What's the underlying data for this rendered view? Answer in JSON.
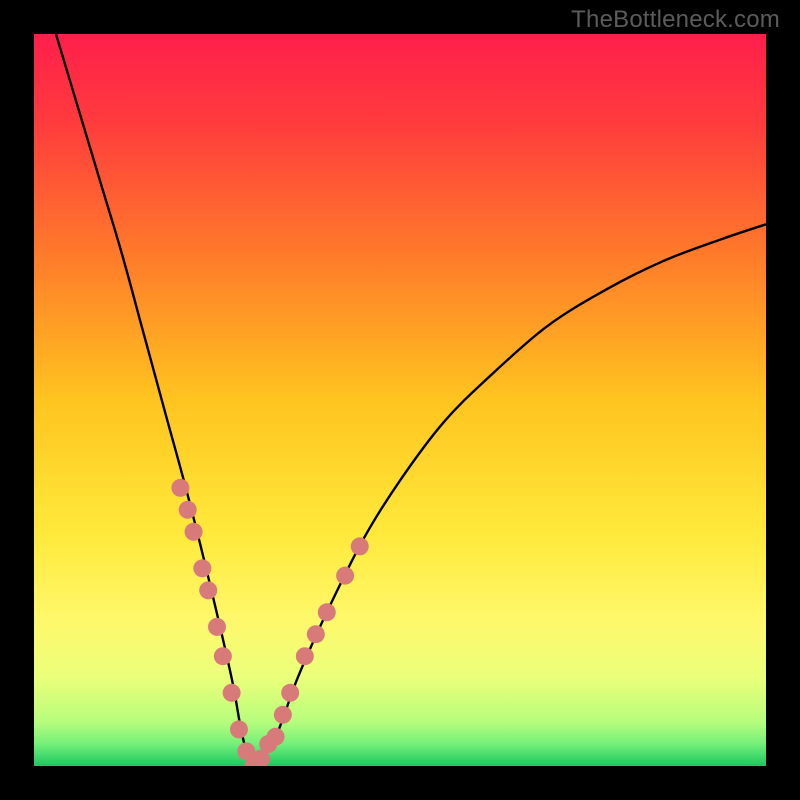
{
  "watermark": "TheBottleneck.com",
  "chart_data": {
    "type": "line",
    "title": "",
    "xlabel": "",
    "ylabel": "",
    "xlim": [
      0,
      100
    ],
    "ylim": [
      0,
      100
    ],
    "background_gradient_stops": [
      {
        "offset": 0.0,
        "color": "#ff1f4b"
      },
      {
        "offset": 0.12,
        "color": "#ff3b3d"
      },
      {
        "offset": 0.3,
        "color": "#ff7a2a"
      },
      {
        "offset": 0.5,
        "color": "#ffc41f"
      },
      {
        "offset": 0.68,
        "color": "#ffe93a"
      },
      {
        "offset": 0.8,
        "color": "#fff86b"
      },
      {
        "offset": 0.88,
        "color": "#eaff7a"
      },
      {
        "offset": 0.94,
        "color": "#b6fd7c"
      },
      {
        "offset": 0.97,
        "color": "#74f07a"
      },
      {
        "offset": 1.0,
        "color": "#1cc760"
      }
    ],
    "series": [
      {
        "name": "bottleneck-curve",
        "x": [
          3,
          6,
          9,
          12,
          15,
          18,
          21,
          24,
          27,
          28.5,
          30,
          33,
          36,
          40,
          45,
          50,
          56,
          62,
          70,
          78,
          86,
          94,
          100
        ],
        "values": [
          100,
          90,
          80,
          70,
          59,
          48,
          37,
          25,
          12,
          4,
          0,
          4,
          12,
          21,
          31,
          39,
          47,
          53,
          60,
          65,
          69,
          72,
          74
        ]
      }
    ],
    "markers": {
      "name": "highlight-points",
      "color": "#d97a7a",
      "radius": 9,
      "points": [
        {
          "x": 20.0,
          "y": 38
        },
        {
          "x": 21.0,
          "y": 35
        },
        {
          "x": 21.8,
          "y": 32
        },
        {
          "x": 23.0,
          "y": 27
        },
        {
          "x": 23.8,
          "y": 24
        },
        {
          "x": 25.0,
          "y": 19
        },
        {
          "x": 25.8,
          "y": 15
        },
        {
          "x": 27.0,
          "y": 10
        },
        {
          "x": 28.0,
          "y": 5
        },
        {
          "x": 29.0,
          "y": 2
        },
        {
          "x": 30.0,
          "y": 0
        },
        {
          "x": 31.0,
          "y": 1
        },
        {
          "x": 32.0,
          "y": 3
        },
        {
          "x": 33.0,
          "y": 4
        },
        {
          "x": 34.0,
          "y": 7
        },
        {
          "x": 35.0,
          "y": 10
        },
        {
          "x": 37.0,
          "y": 15
        },
        {
          "x": 38.5,
          "y": 18
        },
        {
          "x": 40.0,
          "y": 21
        },
        {
          "x": 42.5,
          "y": 26
        },
        {
          "x": 44.5,
          "y": 30
        }
      ]
    }
  }
}
